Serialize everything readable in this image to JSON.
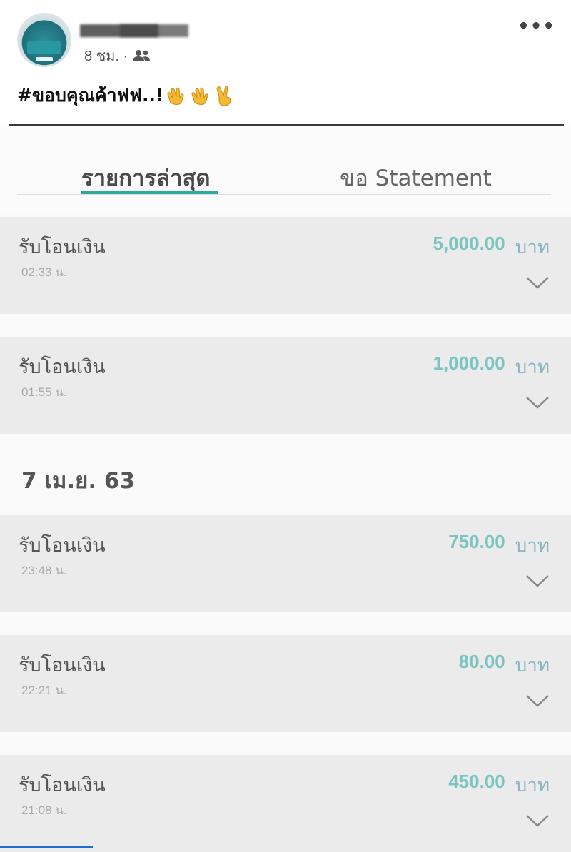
{
  "post": {
    "time": "8 ชม. ·",
    "caption": "#ขอบคุณค้าฟฟ..!",
    "emoji_names": [
      "clapping-hands-icon",
      "clapping-hands-icon",
      "victory-hand-icon"
    ]
  },
  "app": {
    "tabs": [
      {
        "label": "รายการล่าสุด",
        "active": true
      },
      {
        "label": "ขอ Statement",
        "active": false
      }
    ],
    "accent_color": "#2eaa9a",
    "amount_color": "#7cc4c0",
    "transactions_today": [
      {
        "title": "รับโอนเงิน",
        "time": "02:33 น.",
        "amount": "5,000.00",
        "currency": "บาท"
      },
      {
        "title": "รับโอนเงิน",
        "time": "01:55 น.",
        "amount": "1,000.00",
        "currency": "บาท"
      }
    ],
    "date_header": "7 เม.ย. 63",
    "transactions_prev": [
      {
        "title": "รับโอนเงิน",
        "time": "23:48 น.",
        "amount": "750.00",
        "currency": "บาท"
      },
      {
        "title": "รับโอนเงิน",
        "time": "22:21 น.",
        "amount": "80.00",
        "currency": "บาท"
      },
      {
        "title": "รับโอนเงิน",
        "time": "21:08 น.",
        "amount": "450.00",
        "currency": "บาท"
      }
    ]
  }
}
